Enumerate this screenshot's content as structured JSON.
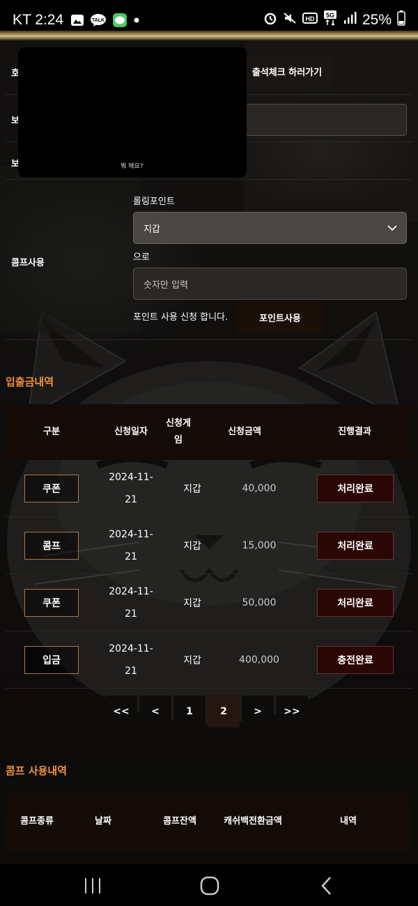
{
  "status_bar": {
    "carrier_time": "KT 2:24",
    "battery": "25%",
    "icons": [
      "gallery-icon",
      "talk-icon",
      "line-icon",
      "dot-icon",
      "alarm-icon",
      "mute-icon",
      "hd-icon",
      "5g-icon",
      "signal-icon",
      "battery-icon"
    ]
  },
  "form": {
    "row1_label": "호",
    "attendance_button": "출석체크 하러가기",
    "row2_label": "보",
    "row3_label": "보",
    "popup_text": "뭐 해요?",
    "comp_label": "콤프사용",
    "rolling_label": "롤링포인트",
    "wallet_select": "지갑",
    "to_label": "으로",
    "amount_placeholder": "숫자만 입력",
    "apply_text": "포인트 사용 신청 합니다.",
    "use_point_button": "포인트사용"
  },
  "history": {
    "title": "입출금내역",
    "headers": [
      "구분",
      "신청일자",
      "신청게임",
      "신청금액",
      "진행결과"
    ],
    "rows": [
      {
        "type": "쿠폰",
        "date": "2024-11-21",
        "game": "지갑",
        "amount": "40,000",
        "status": "처리완료"
      },
      {
        "type": "콤프",
        "date": "2024-11-21",
        "game": "지갑",
        "amount": "15,000",
        "status": "처리완료"
      },
      {
        "type": "쿠폰",
        "date": "2024-11-21",
        "game": "지갑",
        "amount": "50,000",
        "status": "처리완료"
      },
      {
        "type": "입금",
        "date": "2024-11-21",
        "game": "지갑",
        "amount": "400,000",
        "status": "충전완료"
      }
    ]
  },
  "pagination": {
    "first": "<<",
    "prev": "<",
    "pages": [
      "1",
      "2"
    ],
    "active": "2",
    "next": ">",
    "last": ">>"
  },
  "comp_history": {
    "title": "콤프 사용내역",
    "headers": [
      "콤프종류",
      "날짜",
      "콤프잔액",
      "캐쉬백전환금액",
      "내역"
    ]
  },
  "colors": {
    "accent_orange": "#f3913c",
    "status_bg": "#2a0605",
    "table_head_bg": "#140b06"
  }
}
